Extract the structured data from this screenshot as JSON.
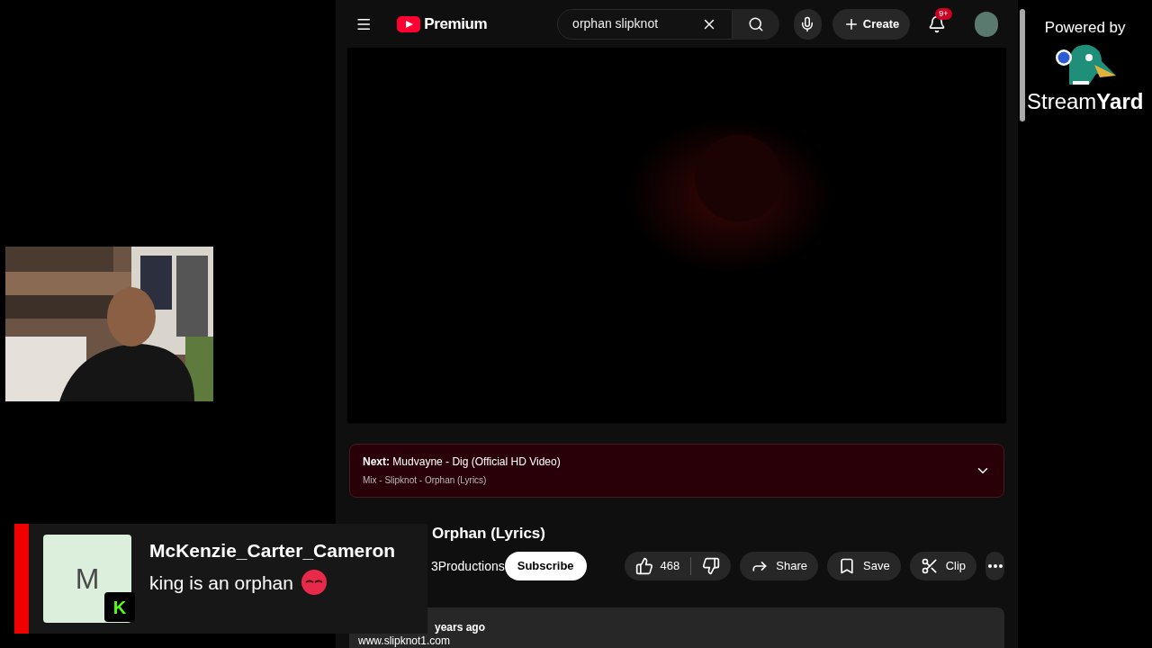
{
  "header": {
    "brand": "Premium",
    "search": {
      "value": "orphan slipknot"
    },
    "create_label": "Create",
    "notification_badge": "9+"
  },
  "up_next": {
    "label": "Next:",
    "title": "Mudvayne - Dig (Official HD Video)",
    "playlist": "Mix - Slipknot - Orphan (Lyrics)"
  },
  "video": {
    "title": "Orphan (Lyrics)",
    "channel": "3Productions",
    "subscribe": "Subscribe",
    "likes": "468",
    "actions": [
      {
        "kind": "share",
        "label": "Share"
      },
      {
        "kind": "save",
        "label": "Save"
      },
      {
        "kind": "clip",
        "label": "Clip"
      }
    ],
    "meta": "years ago",
    "link": "www.slipknot1.com"
  },
  "chat_message": {
    "avatar_letter": "M",
    "badge_letter": "K",
    "username": "McKenzie_Carter_Cameron",
    "text": "king is an orphan"
  },
  "branding": {
    "powered_by": "Powered by",
    "name_light": "Stream",
    "name_bold": "Yard"
  }
}
